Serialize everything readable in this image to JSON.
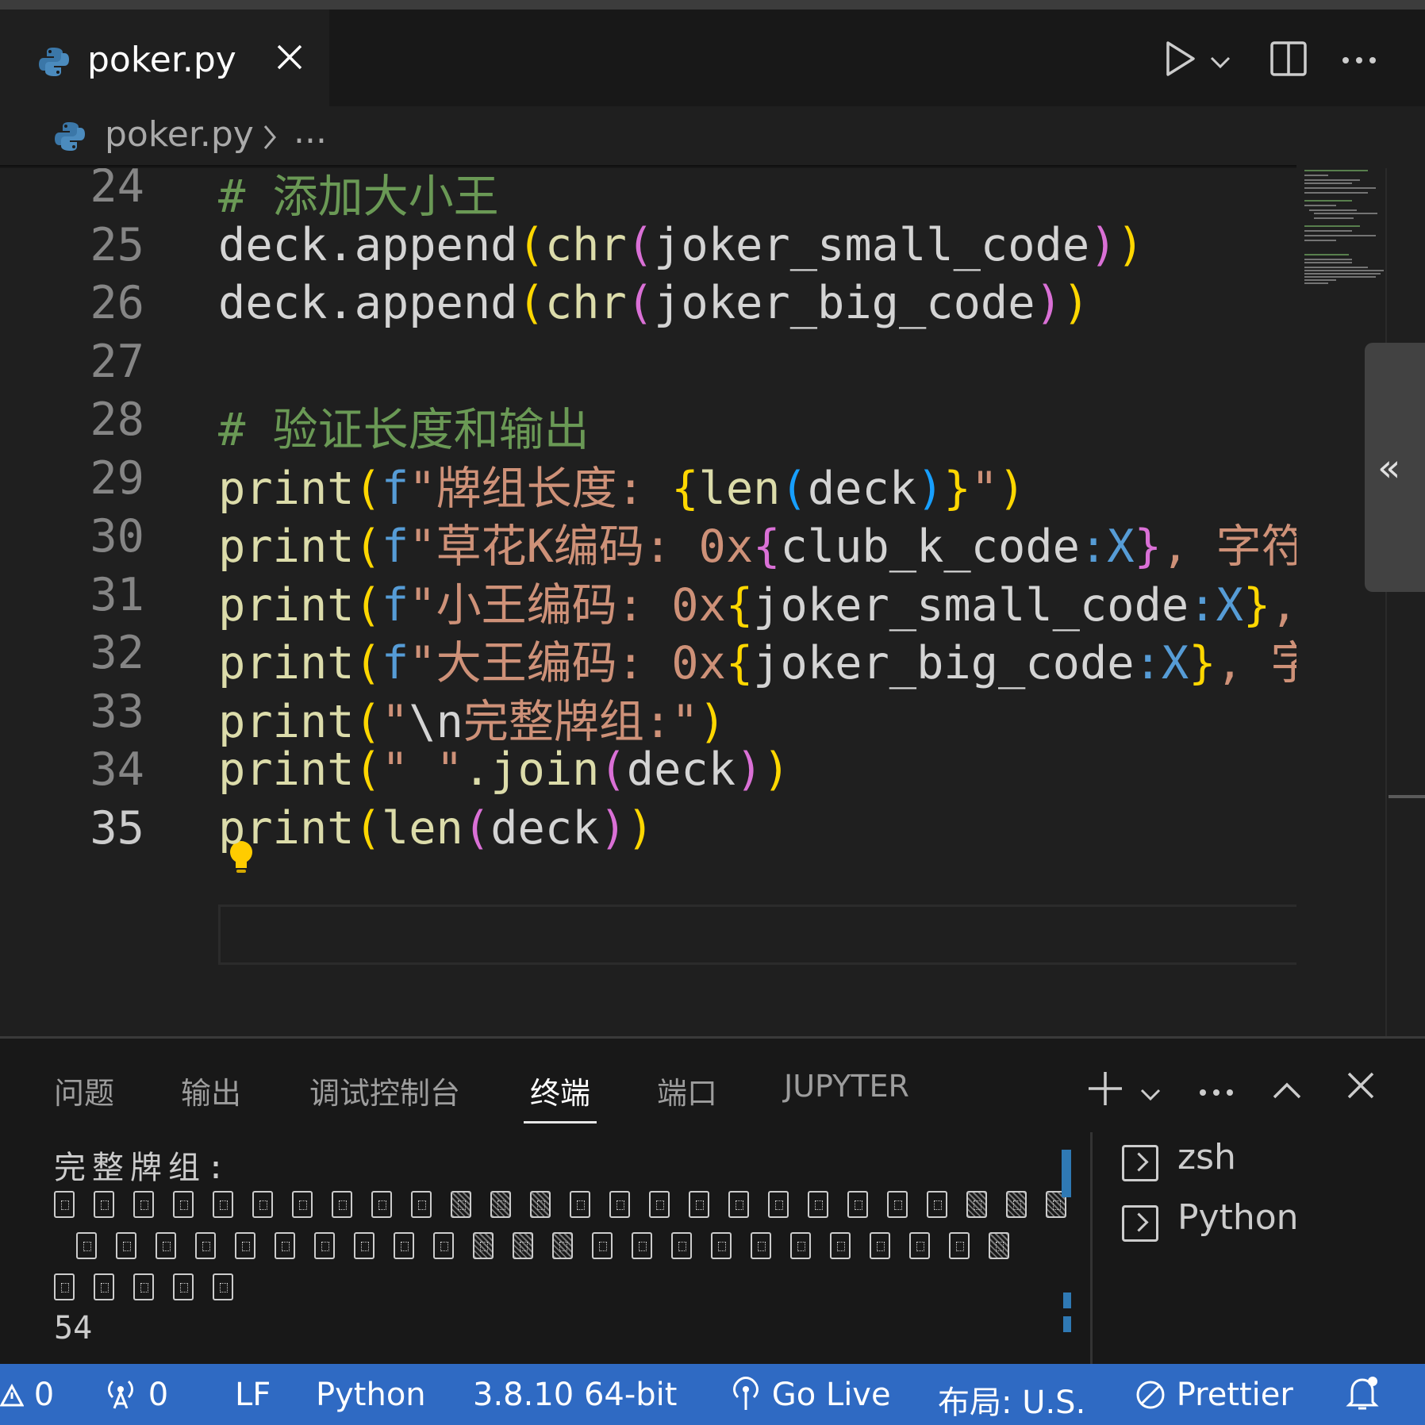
{
  "tab": {
    "filename": "poker.py"
  },
  "breadcrumb": {
    "file": "poker.py",
    "more": "..."
  },
  "editor": {
    "lines": [
      {
        "num": "24",
        "tokens": [
          {
            "t": "# 添加大小王",
            "c": "cm"
          }
        ]
      },
      {
        "num": "25",
        "tokens": [
          {
            "t": "deck.append",
            "c": "id"
          },
          {
            "t": "(",
            "c": "p1"
          },
          {
            "t": "chr",
            "c": "fn"
          },
          {
            "t": "(",
            "c": "p2"
          },
          {
            "t": "joker_small_code",
            "c": "id"
          },
          {
            "t": ")",
            "c": "p2"
          },
          {
            "t": ")",
            "c": "p1"
          }
        ]
      },
      {
        "num": "26",
        "tokens": [
          {
            "t": "deck.append",
            "c": "id"
          },
          {
            "t": "(",
            "c": "p1"
          },
          {
            "t": "chr",
            "c": "fn"
          },
          {
            "t": "(",
            "c": "p2"
          },
          {
            "t": "joker_big_code",
            "c": "id"
          },
          {
            "t": ")",
            "c": "p2"
          },
          {
            "t": ")",
            "c": "p1"
          }
        ]
      },
      {
        "num": "27",
        "tokens": []
      },
      {
        "num": "28",
        "tokens": [
          {
            "t": "# 验证长度和输出",
            "c": "cm"
          }
        ]
      },
      {
        "num": "29",
        "tokens": [
          {
            "t": "print",
            "c": "fn"
          },
          {
            "t": "(",
            "c": "p1"
          },
          {
            "t": "f",
            "c": "kw"
          },
          {
            "t": "\"牌组长度: ",
            "c": "st"
          },
          {
            "t": "{",
            "c": "p1"
          },
          {
            "t": "len",
            "c": "fn"
          },
          {
            "t": "(",
            "c": "p3"
          },
          {
            "t": "deck",
            "c": "id"
          },
          {
            "t": ")",
            "c": "p3"
          },
          {
            "t": "}",
            "c": "p1"
          },
          {
            "t": "\"",
            "c": "st"
          },
          {
            "t": ")",
            "c": "p1"
          }
        ]
      },
      {
        "num": "30",
        "tokens": [
          {
            "t": "print",
            "c": "fn"
          },
          {
            "t": "(",
            "c": "p1"
          },
          {
            "t": "f",
            "c": "kw"
          },
          {
            "t": "\"草花K编码: 0x",
            "c": "st"
          },
          {
            "t": "{",
            "c": "p2"
          },
          {
            "t": "club_k_code",
            "c": "id"
          },
          {
            "t": ":X",
            "c": "kw"
          },
          {
            "t": "}",
            "c": "p2"
          },
          {
            "t": ", 字符:",
            "c": "st"
          }
        ]
      },
      {
        "num": "31",
        "tokens": [
          {
            "t": "print",
            "c": "fn"
          },
          {
            "t": "(",
            "c": "p1"
          },
          {
            "t": "f",
            "c": "kw"
          },
          {
            "t": "\"小王编码: 0x",
            "c": "st"
          },
          {
            "t": "{",
            "c": "p1"
          },
          {
            "t": "joker_small_code",
            "c": "id"
          },
          {
            "t": ":X",
            "c": "kw"
          },
          {
            "t": "}",
            "c": "p1"
          },
          {
            "t": ",",
            "c": "st"
          }
        ]
      },
      {
        "num": "32",
        "tokens": [
          {
            "t": "print",
            "c": "fn"
          },
          {
            "t": "(",
            "c": "p1"
          },
          {
            "t": "f",
            "c": "kw"
          },
          {
            "t": "\"大王编码: 0x",
            "c": "st"
          },
          {
            "t": "{",
            "c": "p1"
          },
          {
            "t": "joker_big_code",
            "c": "id"
          },
          {
            "t": ":X",
            "c": "kw"
          },
          {
            "t": "}",
            "c": "p1"
          },
          {
            "t": ", 字",
            "c": "st"
          }
        ]
      },
      {
        "num": "33",
        "tokens": [
          {
            "t": "print",
            "c": "fn"
          },
          {
            "t": "(",
            "c": "p1"
          },
          {
            "t": "\"",
            "c": "st"
          },
          {
            "t": "\\n",
            "c": "id"
          },
          {
            "t": "完整牌组:\"",
            "c": "st"
          },
          {
            "t": ")",
            "c": "p1"
          }
        ]
      },
      {
        "num": "34",
        "tokens": [
          {
            "t": "print",
            "c": "fn"
          },
          {
            "t": "(",
            "c": "p1"
          },
          {
            "t": "\" \"",
            "c": "st"
          },
          {
            "t": ".join",
            "c": "fn"
          },
          {
            "t": "(",
            "c": "p2"
          },
          {
            "t": "deck",
            "c": "id"
          },
          {
            "t": ")",
            "c": "p2"
          },
          {
            "t": ")",
            "c": "p1"
          }
        ]
      },
      {
        "num": "35",
        "tokens": [
          {
            "t": "print",
            "c": "fn"
          },
          {
            "t": "(",
            "c": "p1"
          },
          {
            "t": "len",
            "c": "fn"
          },
          {
            "t": "(",
            "c": "p2"
          },
          {
            "t": "deck",
            "c": "id"
          },
          {
            "t": ")",
            "c": "p2"
          },
          {
            "t": ")",
            "c": "p1"
          }
        ]
      }
    ],
    "active_line": "35"
  },
  "panel": {
    "tabs": [
      "问题",
      "输出",
      "调试控制台",
      "终端",
      "端口",
      "JUPYTER"
    ],
    "active_tab": "终端",
    "terminal": {
      "heading": "完整牌组:",
      "card_rows": [
        26,
        24,
        5
      ],
      "count_output": "54"
    },
    "terminals": [
      "zsh",
      "Python"
    ]
  },
  "status": {
    "errors": "0",
    "ports": "0",
    "eol": "LF",
    "language": "Python",
    "interpreter": "3.8.10 64-bit",
    "go_live": "Go Live",
    "layout": "布局: U.S.",
    "prettier": "Prettier"
  },
  "colors": {
    "status_bar": "#2f6ac3",
    "editor_bg": "#1f1f1f",
    "panel_bg": "#181818"
  }
}
